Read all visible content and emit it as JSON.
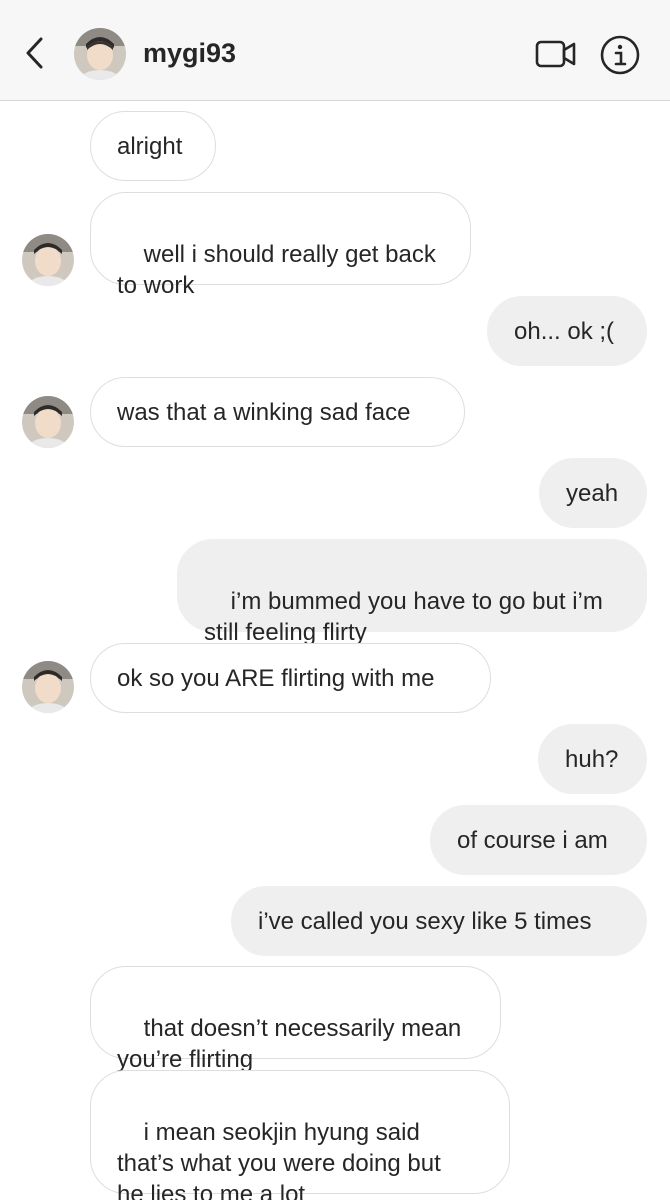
{
  "header": {
    "username": "mygi93",
    "icons": {
      "back": "chevron-left-icon",
      "avatar": "avatar",
      "video": "video-camera-icon",
      "info": "info-icon"
    }
  },
  "messages": [
    {
      "from": "them",
      "text": "alright"
    },
    {
      "from": "them",
      "text": "well i should really get back\nto work"
    },
    {
      "from": "me",
      "text": "oh... ok ;("
    },
    {
      "from": "them",
      "text": "was that a winking sad face"
    },
    {
      "from": "me",
      "text": "yeah"
    },
    {
      "from": "me",
      "text": "i’m bummed you have to go but i’m\nstill feeling flirty"
    },
    {
      "from": "them",
      "text": "ok so you ARE flirting with me"
    },
    {
      "from": "me",
      "text": "huh?"
    },
    {
      "from": "me",
      "text": "of course i am"
    },
    {
      "from": "me",
      "text": "i’ve called you sexy like 5 times"
    },
    {
      "from": "them",
      "text": "that doesn’t necessarily mean\nyou’re flirting"
    },
    {
      "from": "them",
      "text": "i mean seokjin hyung said\nthat’s what you were doing but\nhe lies to me a lot"
    }
  ],
  "colors": {
    "incoming_bubble": "#ffffff",
    "incoming_border": "#dedede",
    "outgoing_bubble": "#efefef",
    "text": "#262626",
    "header_bg": "#f7f7f7"
  }
}
